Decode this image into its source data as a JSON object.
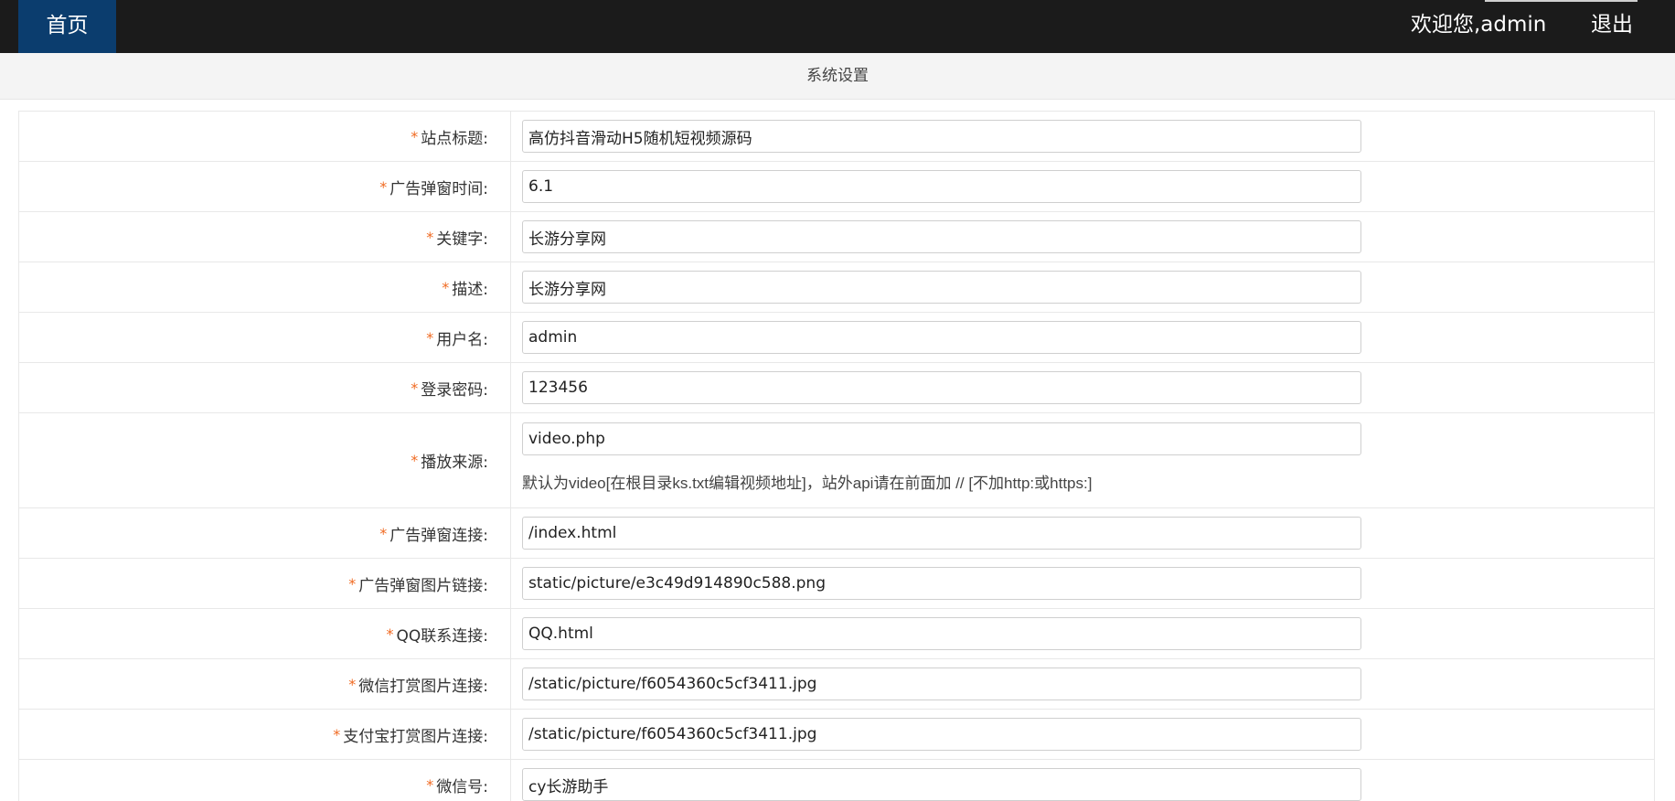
{
  "header": {
    "home_label": "首页",
    "welcome_text": "欢迎您,admin",
    "logout_label": "退出"
  },
  "page_title": "系统设置",
  "form": {
    "required_mark": "*",
    "fields": [
      {
        "label": "站点标题:",
        "value": "高仿抖音滑动H5随机短视频源码"
      },
      {
        "label": "广告弹窗时间:",
        "value": "6.1"
      },
      {
        "label": "关键字:",
        "value": "长游分享网"
      },
      {
        "label": "描述:",
        "value": "长游分享网"
      },
      {
        "label": "用户名:",
        "value": "admin"
      },
      {
        "label": "登录密码:",
        "value": "123456"
      },
      {
        "label": "播放来源:",
        "value": "video.php",
        "hint": "默认为video[在根目录ks.txt编辑视频地址]，站外api请在前面加 // [不加http:或https:]"
      },
      {
        "label": "广告弹窗连接:",
        "value": "/index.html"
      },
      {
        "label": "广告弹窗图片链接:",
        "value": "static/picture/e3c49d914890c588.png"
      },
      {
        "label": "QQ联系连接:",
        "value": "QQ.html"
      },
      {
        "label": "微信打赏图片连接:",
        "value": "/static/picture/f6054360c5cf3411.jpg"
      },
      {
        "label": "支付宝打赏图片连接:",
        "value": "/static/picture/f6054360c5cf3411.jpg"
      },
      {
        "label": "微信号:",
        "value": "cy长游助手"
      }
    ]
  }
}
